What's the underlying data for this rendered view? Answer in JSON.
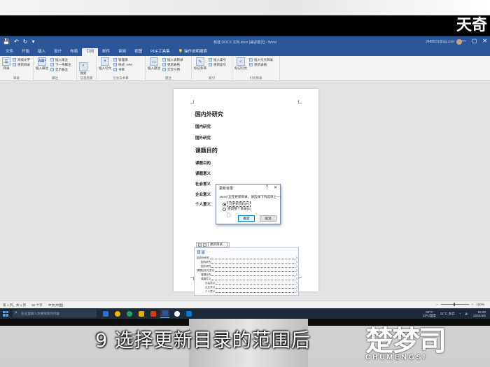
{
  "brand_overlay": "天奇",
  "titlebar": {
    "quick_access": [
      "💾",
      "↶",
      "↻",
      "▾"
    ],
    "doc_title": "新建 DOCX 文档.docx [兼容模式] - Word",
    "account": "2488831@qq.com",
    "window_controls": [
      "—",
      "▢",
      "✕"
    ]
  },
  "tabs": [
    "文件",
    "开始",
    "插入",
    "设计",
    "布局",
    "引用",
    "邮件",
    "审阅",
    "视图",
    "PDF工具集",
    "💡 操作说明搜索"
  ],
  "ribbon": {
    "toc_group": {
      "big": "目录",
      "items": [
        "添加文字",
        "更新目录"
      ],
      "label": "目录"
    },
    "footnote_group": {
      "big": "插入脚注",
      "items": [
        "插入尾注",
        "下一条脚注",
        "显示备注"
      ],
      "label": "脚注"
    },
    "research_group": {
      "big": "搜索",
      "label": "信息检索"
    },
    "citation_group": {
      "big": "插入引文",
      "items": [
        "管理源",
        "样式: APA",
        "书目"
      ],
      "label": "引文与书目"
    },
    "caption_group": {
      "big": "插入题注",
      "items": [
        "插入表目录",
        "更新表格",
        "交叉引用"
      ],
      "label": "题注"
    },
    "index_group": {
      "big": "标记条目",
      "items": [
        "插入索引",
        "更新索引"
      ],
      "label": "索引"
    },
    "authority_group": {
      "big": "标记引文",
      "items": [
        "插入引文目录",
        "更新表格"
      ],
      "label": "引文目录"
    }
  },
  "document": {
    "headings": [
      {
        "text": "国内外研究",
        "level": 1
      },
      {
        "text": "国内研究",
        "level": 2
      },
      {
        "text": "国外研究",
        "level": 2
      },
      {
        "text": "课题目的",
        "level": 1
      },
      {
        "text": "课题目的",
        "level": 2
      },
      {
        "text": "课题意义",
        "level": 2
      },
      {
        "text": "社会意义",
        "level": 2
      },
      {
        "text": "企业意义",
        "level": 2
      },
      {
        "text": "个人意义",
        "level": 2
      }
    ],
    "toc_toolbar": {
      "update_label": "更新目录..."
    },
    "toc_title": "目录",
    "toc_lines": [
      {
        "text": "国内外研究",
        "page": "1"
      },
      {
        "text": "国内研究",
        "page": "1"
      },
      {
        "text": "国外研究",
        "page": "1"
      },
      {
        "text": "课题目的与意义",
        "page": "1"
      },
      {
        "text": "课题目的",
        "page": "1"
      },
      {
        "text": "课题意义",
        "page": "1"
      },
      {
        "text": "社会意义",
        "page": "1"
      },
      {
        "text": "企业意义",
        "page": "1"
      },
      {
        "text": "个人意义",
        "page": "1"
      }
    ]
  },
  "dialog": {
    "title": "更新目录",
    "help": "?",
    "close": "✕",
    "message": "Word 正在更新目录，请选择下列选项之一：",
    "option_page_numbers": "只更新页码(P)",
    "option_entire": "更新整个目录(E)",
    "ok_label": "确定",
    "cancel_label": "取消"
  },
  "statusbar": {
    "page": "第 1 页，共 1 页",
    "words": "91 个字",
    "lang": "中文(中国)",
    "zoom": "100%"
  },
  "taskbar": {
    "search_placeholder": "在这里输入你要搜索的内容",
    "app_colors": [
      "#2b6fd6",
      "#f4b400",
      "#20a464",
      "#e8b100",
      "#d83b01",
      "#2b579a",
      "#ffffff",
      "#0078d7"
    ],
    "cpu": "56°C",
    "cpu_label": "CPU温度",
    "weather": "21°C 多云",
    "time": "16:20",
    "date": "2022/4/6"
  },
  "subtitle": "9 选择更新目录的范围后",
  "watermark": {
    "glyphs": "楚梦司",
    "latin": "CHUMENGSI"
  }
}
